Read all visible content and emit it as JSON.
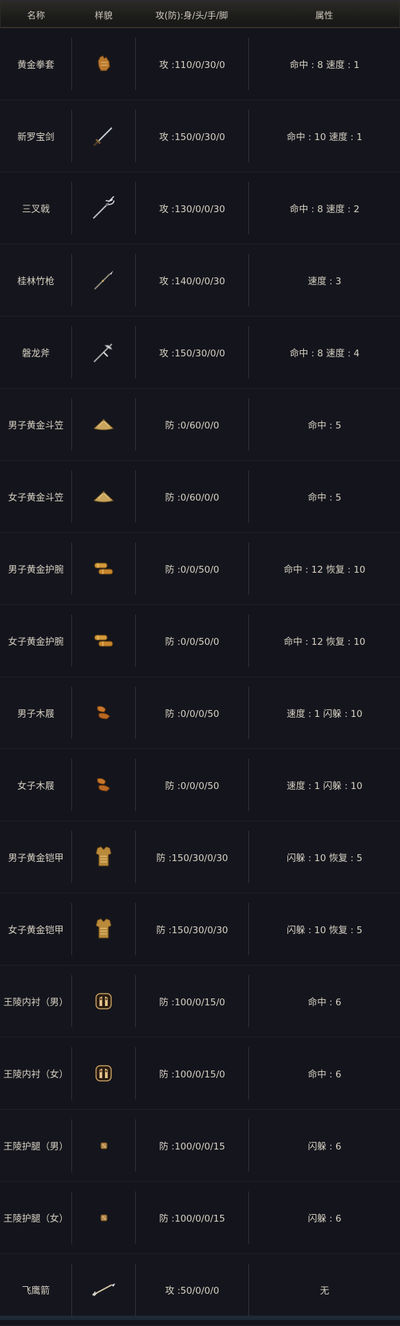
{
  "header": {
    "name": "名称",
    "image": "样貌",
    "stats": "攻(防):身/头/手/脚",
    "attr": "属性"
  },
  "items": [
    {
      "name": "黄金拳套",
      "icon": "gauntlet-icon",
      "stats": "攻 :110/0/30/0",
      "attr": "命中 : 8 速度 : 1"
    },
    {
      "name": "新罗宝剑",
      "icon": "sword-icon",
      "stats": "攻 :150/0/30/0",
      "attr": "命中 : 10 速度 : 1"
    },
    {
      "name": "三叉戟",
      "icon": "trident-icon",
      "stats": "攻 :130/0/0/30",
      "attr": "命中 : 8 速度 : 2"
    },
    {
      "name": "桂林竹枪",
      "icon": "spear-icon",
      "stats": "攻 :140/0/0/30",
      "attr": "速度 : 3"
    },
    {
      "name": "磐龙斧",
      "icon": "halberd-icon",
      "stats": "攻 :150/30/0/0",
      "attr": "命中 : 8 速度 : 4"
    },
    {
      "name": "男子黄金斗笠",
      "icon": "straw-hat-icon",
      "stats": "防 :0/60/0/0",
      "attr": "命中 : 5"
    },
    {
      "name": "女子黄金斗笠",
      "icon": "straw-hat-icon",
      "stats": "防 :0/60/0/0",
      "attr": "命中 : 5"
    },
    {
      "name": "男子黄金护腕",
      "icon": "bracer-icon",
      "stats": "防 :0/0/50/0",
      "attr": "命中 : 12 恢复 : 10"
    },
    {
      "name": "女子黄金护腕",
      "icon": "bracer-icon",
      "stats": "防 :0/0/50/0",
      "attr": "命中 : 12 恢复 : 10"
    },
    {
      "name": "男子木屐",
      "icon": "clog-icon",
      "stats": "防 :0/0/0/50",
      "attr": "速度 : 1 闪躲 : 10"
    },
    {
      "name": "女子木屐",
      "icon": "clog-icon",
      "stats": "防 :0/0/0/50",
      "attr": "速度 : 1 闪躲 : 10"
    },
    {
      "name": "男子黄金铠甲",
      "icon": "armor-icon",
      "stats": "防 :150/30/0/30",
      "attr": "闪躲 : 10 恢复 : 5"
    },
    {
      "name": "女子黄金铠甲",
      "icon": "armor-icon",
      "stats": "防 :150/30/0/30",
      "attr": "闪躲 : 10 恢复 : 5"
    },
    {
      "name": "王陵内衬（男）",
      "icon": "inner-shirt-icon",
      "stats": "防 :100/0/15/0",
      "attr": "命中 : 6"
    },
    {
      "name": "王陵内衬（女）",
      "icon": "inner-shirt-icon",
      "stats": "防 :100/0/15/0",
      "attr": "命中 : 6"
    },
    {
      "name": "王陵护腿（男）",
      "icon": "leg-guard-icon",
      "stats": "防 :100/0/0/15",
      "attr": "闪躲 : 6"
    },
    {
      "name": "王陵护腿（女）",
      "icon": "leg-guard-icon",
      "stats": "防 :100/0/0/15",
      "attr": "闪躲 : 6"
    },
    {
      "name": "飞鹰箭",
      "icon": "arrow-icon",
      "stats": "攻 :50/0/0/0",
      "attr": "无"
    }
  ]
}
